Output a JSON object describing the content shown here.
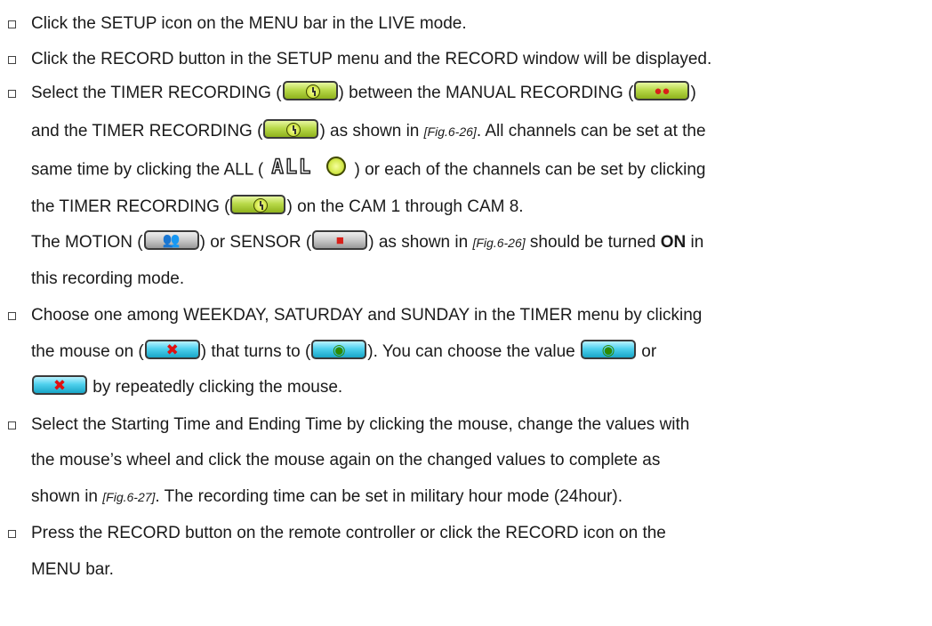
{
  "items": [
    {
      "lines": [
        [
          {
            "t": "Click the SETUP icon on the MENU bar in the LIVE mode."
          }
        ]
      ]
    },
    {
      "lines": [
        [
          {
            "t": "Click the RECORD button in the SETUP menu and the RECORD window will be displayed."
          }
        ]
      ]
    },
    {
      "lines": [
        [
          {
            "t": "Select the TIMER RECORDING ("
          },
          {
            "icon": "timer-recording-icon"
          },
          {
            "t": ") between the MANUAL RECORDING ("
          },
          {
            "icon": "manual-recording-icon"
          },
          {
            "t": ")"
          }
        ],
        [
          {
            "t": "and the TIMER RECORDING ("
          },
          {
            "icon": "timer-recording-icon"
          },
          {
            "t": ") as shown in "
          },
          {
            "ref": "[Fig.6-26]"
          },
          {
            "t": ". All channels can be set at the"
          }
        ],
        [
          {
            "t": "same time by clicking the ALL ( "
          },
          {
            "icon": "all-timer-icon"
          },
          {
            "t": " ) or each of the channels can be set by clicking"
          }
        ],
        [
          {
            "t": "the TIMER RECORDING ("
          },
          {
            "icon": "timer-recording-icon"
          },
          {
            "t": ") on the CAM 1 through CAM 8."
          }
        ],
        [
          {
            "t": "The MOTION ("
          },
          {
            "icon": "motion-icon"
          },
          {
            "t": ") or SENSOR ("
          },
          {
            "icon": "sensor-icon"
          },
          {
            "t": ") as shown in "
          },
          {
            "ref": "[Fig.6-26]"
          },
          {
            "t": " should be turned "
          },
          {
            "b": "ON"
          },
          {
            "t": " in"
          }
        ],
        [
          {
            "t": "this recording mode."
          }
        ]
      ]
    },
    {
      "lines": [
        [
          {
            "t": "Choose one among WEEKDAY, SATURDAY and SUNDAY in the TIMER menu by clicking"
          }
        ],
        [
          {
            "t": "the mouse on ("
          },
          {
            "icon": "off-x-icon"
          },
          {
            "t": ") that turns to ("
          },
          {
            "icon": "on-check-icon"
          },
          {
            "t": "). You can choose the value "
          },
          {
            "icon": "on-check-icon"
          },
          {
            "t": " or"
          }
        ],
        [
          {
            "icon": "off-x-icon"
          },
          {
            "t": " by repeatedly clicking the mouse."
          }
        ]
      ]
    },
    {
      "lines": [
        [
          {
            "t": "Select the Starting Time and Ending Time by clicking the mouse, change the values with"
          }
        ],
        [
          {
            "t": "the mouse’s wheel and click the mouse again on the changed values to complete as"
          }
        ],
        [
          {
            "t": "shown in "
          },
          {
            "ref": "[Fig.6-27]"
          },
          {
            "t": ". The recording time can be set in military hour mode (24hour)."
          }
        ]
      ]
    },
    {
      "lines": [
        [
          {
            "t": "Press the RECORD button on the remote controller or click the RECORD icon on the"
          }
        ],
        [
          {
            "t": "MENU bar."
          }
        ]
      ]
    }
  ],
  "icon_text": {
    "all_label": "ALL",
    "x_mark": "✖",
    "check_mark": "◉",
    "motion_mark": "👥",
    "sensor_mark": "■"
  }
}
